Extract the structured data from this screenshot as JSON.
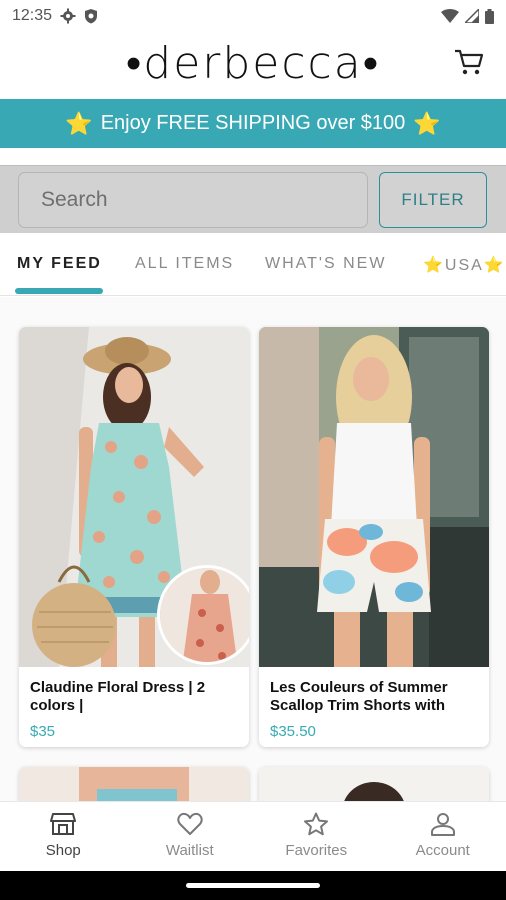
{
  "status_bar": {
    "time": "12:35",
    "icons_left": [
      "gear-icon",
      "shield-icon"
    ],
    "icons_right": [
      "wifi-icon",
      "signal-icon",
      "battery-icon"
    ]
  },
  "header": {
    "logo": "•derbecca•",
    "cart_icon": "cart-icon"
  },
  "promo": {
    "text": "Enjoy FREE SHIPPING over $100",
    "star": "⭐",
    "bg_color": "#38a9b4"
  },
  "search": {
    "placeholder": "Search",
    "filter_label": "FILTER"
  },
  "tabs": [
    {
      "label": "MY FEED",
      "active": true
    },
    {
      "label": "ALL ITEMS",
      "active": false
    },
    {
      "label": "WHAT'S NEW",
      "active": false
    },
    {
      "label": "⭐USA⭐",
      "active": false
    }
  ],
  "products": [
    {
      "title": "Claudine Floral Dress | 2 colors |",
      "price": "$35"
    },
    {
      "title": "Les Couleurs of Summer Scallop Trim Shorts with",
      "price": "$35.50"
    }
  ],
  "bottom_nav": [
    {
      "label": "Shop",
      "icon": "store-icon",
      "active": true
    },
    {
      "label": "Waitlist",
      "icon": "heart-icon",
      "active": false
    },
    {
      "label": "Favorites",
      "icon": "star-icon",
      "active": false
    },
    {
      "label": "Account",
      "icon": "person-icon",
      "active": false
    }
  ],
  "colors": {
    "accent": "#38a9b4",
    "price": "#38a9b4"
  }
}
